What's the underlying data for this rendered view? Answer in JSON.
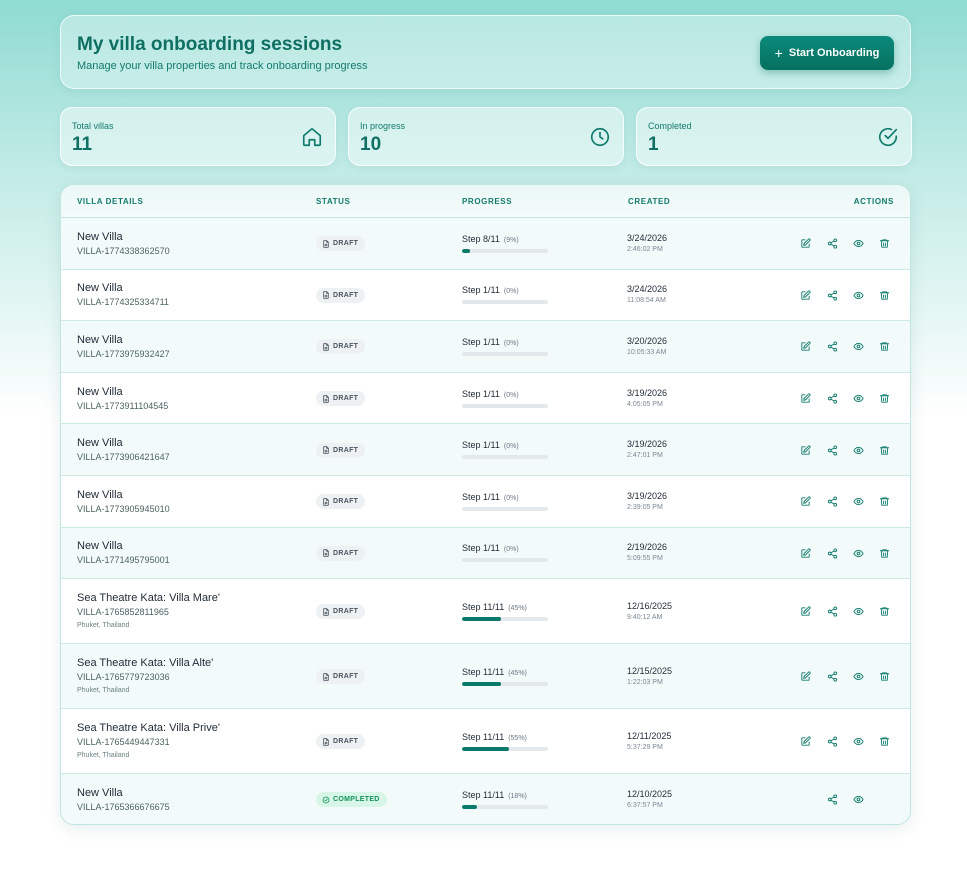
{
  "header": {
    "title": "My villa onboarding sessions",
    "subtitle": "Manage your villa properties and track onboarding progress",
    "start_button": "Start Onboarding"
  },
  "stats": [
    {
      "label": "Total villas",
      "value": "11",
      "icon": "home-icon"
    },
    {
      "label": "In progress",
      "value": "10",
      "icon": "clock-icon"
    },
    {
      "label": "Completed",
      "value": "1",
      "icon": "check-circle-icon"
    }
  ],
  "table": {
    "columns": [
      "VILLA DETAILS",
      "STATUS",
      "PROGRESS",
      "CREATED",
      "ACTIONS"
    ],
    "rows": [
      {
        "name": "New Villa",
        "id": "VILLA-1774338362570",
        "location": "",
        "status": "DRAFT",
        "step": "Step 8/11",
        "percent": "(9%)",
        "progress": 9,
        "date": "3/24/2026",
        "time": "2:46:02 PM",
        "actions": [
          "edit",
          "share",
          "view",
          "delete"
        ]
      },
      {
        "name": "New Villa",
        "id": "VILLA-1774325334711",
        "location": "",
        "status": "DRAFT",
        "step": "Step 1/11",
        "percent": "(0%)",
        "progress": 0,
        "date": "3/24/2026",
        "time": "11:08:54 AM",
        "actions": [
          "edit",
          "share",
          "view",
          "delete"
        ]
      },
      {
        "name": "New Villa",
        "id": "VILLA-1773975932427",
        "location": "",
        "status": "DRAFT",
        "step": "Step 1/11",
        "percent": "(0%)",
        "progress": 0,
        "date": "3/20/2026",
        "time": "10:05:33 AM",
        "actions": [
          "edit",
          "share",
          "view",
          "delete"
        ]
      },
      {
        "name": "New Villa",
        "id": "VILLA-1773911104545",
        "location": "",
        "status": "DRAFT",
        "step": "Step 1/11",
        "percent": "(0%)",
        "progress": 0,
        "date": "3/19/2026",
        "time": "4:05:05 PM",
        "actions": [
          "edit",
          "share",
          "view",
          "delete"
        ]
      },
      {
        "name": "New Villa",
        "id": "VILLA-1773906421647",
        "location": "",
        "status": "DRAFT",
        "step": "Step 1/11",
        "percent": "(0%)",
        "progress": 0,
        "date": "3/19/2026",
        "time": "2:47:01 PM",
        "actions": [
          "edit",
          "share",
          "view",
          "delete"
        ]
      },
      {
        "name": "New Villa",
        "id": "VILLA-1773905945010",
        "location": "",
        "status": "DRAFT",
        "step": "Step 1/11",
        "percent": "(0%)",
        "progress": 0,
        "date": "3/19/2026",
        "time": "2:39:05 PM",
        "actions": [
          "edit",
          "share",
          "view",
          "delete"
        ]
      },
      {
        "name": "New Villa",
        "id": "VILLA-1771495795001",
        "location": "",
        "status": "DRAFT",
        "step": "Step 1/11",
        "percent": "(0%)",
        "progress": 0,
        "date": "2/19/2026",
        "time": "5:09:55 PM",
        "actions": [
          "edit",
          "share",
          "view",
          "delete"
        ]
      },
      {
        "name": "Sea Theatre Kata: Villa Mare'",
        "id": "VILLA-1765852811965",
        "location": "Phuket, Thailand",
        "status": "DRAFT",
        "step": "Step 11/11",
        "percent": "(45%)",
        "progress": 45,
        "date": "12/16/2025",
        "time": "9:40:12 AM",
        "actions": [
          "edit",
          "share",
          "view",
          "delete"
        ]
      },
      {
        "name": "Sea Theatre Kata: Villa Alte'",
        "id": "VILLA-1765779723036",
        "location": "Phuket, Thailand",
        "status": "DRAFT",
        "step": "Step 11/11",
        "percent": "(45%)",
        "progress": 45,
        "date": "12/15/2025",
        "time": "1:22:03 PM",
        "actions": [
          "edit",
          "share",
          "view",
          "delete"
        ]
      },
      {
        "name": "Sea Theatre Kata: Villa Prive'",
        "id": "VILLA-1765449447331",
        "location": "Phuket, Thailand",
        "status": "DRAFT",
        "step": "Step 11/11",
        "percent": "(55%)",
        "progress": 55,
        "date": "12/11/2025",
        "time": "5:37:29 PM",
        "actions": [
          "edit",
          "share",
          "view",
          "delete"
        ]
      },
      {
        "name": "New Villa",
        "id": "VILLA-1765366676675",
        "location": "",
        "status": "COMPLETED",
        "step": "Step 11/11",
        "percent": "(18%)",
        "progress": 18,
        "date": "12/10/2025",
        "time": "6:37:57 PM",
        "actions": [
          "share",
          "view"
        ]
      }
    ]
  },
  "colors": {
    "accent": "#0f6f63",
    "button": "#06705f",
    "progress_fill": "#0a7a6a",
    "completed": "#14925a"
  }
}
